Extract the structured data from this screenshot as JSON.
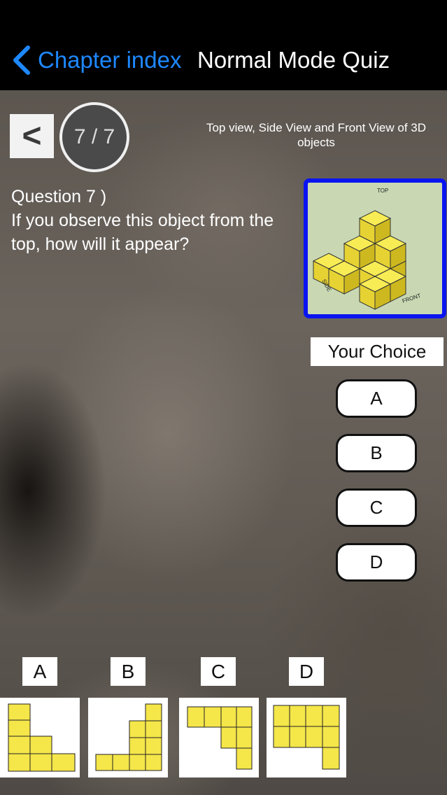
{
  "nav": {
    "back_label": "Chapter index",
    "title": "Normal Mode Quiz"
  },
  "quiz": {
    "prev_label": "<",
    "progress": "7 / 7",
    "topic": "Top view, Side View and Front View of 3D objects",
    "question_number": "Question 7 )",
    "question_text": "If you observe this object from the top, how will it appear?",
    "object_labels": {
      "top": "TOP",
      "side": "SIDE",
      "front": "FRONT"
    }
  },
  "choice": {
    "title": "Your Choice",
    "buttons": [
      "A",
      "B",
      "C",
      "D"
    ]
  },
  "options": [
    {
      "label": "A",
      "icon": "top-view-option-a"
    },
    {
      "label": "B",
      "icon": "top-view-option-b"
    },
    {
      "label": "C",
      "icon": "top-view-option-c"
    },
    {
      "label": "D",
      "icon": "top-view-option-d"
    }
  ],
  "colors": {
    "accent": "#1e88ff",
    "frame": "#0a14f0",
    "cube": "#f5e64a"
  }
}
